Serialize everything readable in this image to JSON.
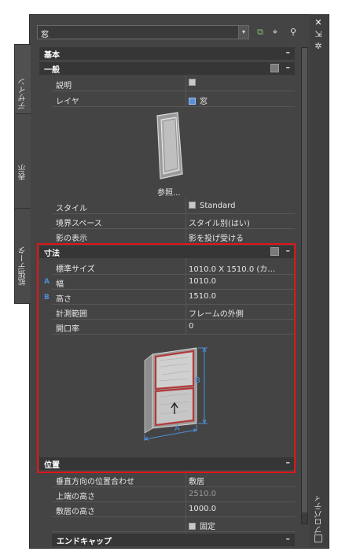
{
  "style_selector": {
    "value": "窓"
  },
  "toolbar_icons": [
    "add-selection-icon",
    "select-objects-icon",
    "quick-select-icon"
  ],
  "side_tabs": [
    "デザイン",
    "表示",
    "拡張データ"
  ],
  "right_strip": {
    "label": "プロパティ"
  },
  "sections": {
    "basic": "基本",
    "general": "一般",
    "dimensions": "寸法",
    "location": "位置",
    "endcap": "エンドキャップ"
  },
  "general_rows": {
    "description_label": "説明",
    "layer_label": "レイヤ",
    "layer_value": "窓",
    "preview_caption": "参照...",
    "style_label": "スタイル",
    "style_value": "Standard",
    "bound_space_label": "境界スペース",
    "bound_space_value": "スタイル別(はい)",
    "shadow_label": "影の表示",
    "shadow_value": "影を投げ受ける"
  },
  "dimension_rows": {
    "standard_size_label": "標準サイズ",
    "standard_size_value": "1010.0 X   1510.0 (カ…",
    "width_marker": "A",
    "width_label": "幅",
    "width_value": "1010.0",
    "height_marker": "B",
    "height_label": "高さ",
    "height_value": "1510.0",
    "measure_label": "計測範囲",
    "measure_value": "フレームの外側",
    "opening_label": "開口率",
    "opening_value": "0",
    "diagram_a": "A",
    "diagram_b": "B"
  },
  "location_rows": {
    "vertical_align_label": "垂直方向の位置合わせ",
    "vertical_align_value": "敷居",
    "head_height_label": "上端の高さ",
    "head_height_value": "2510.0",
    "sill_height_label": "敷居の高さ",
    "sill_height_value": "1000.0",
    "fixed_value": "固定"
  },
  "colors": {
    "highlight": "#e0161b",
    "marker": "#4d8fd6",
    "frame_red": "#b23a3a"
  }
}
